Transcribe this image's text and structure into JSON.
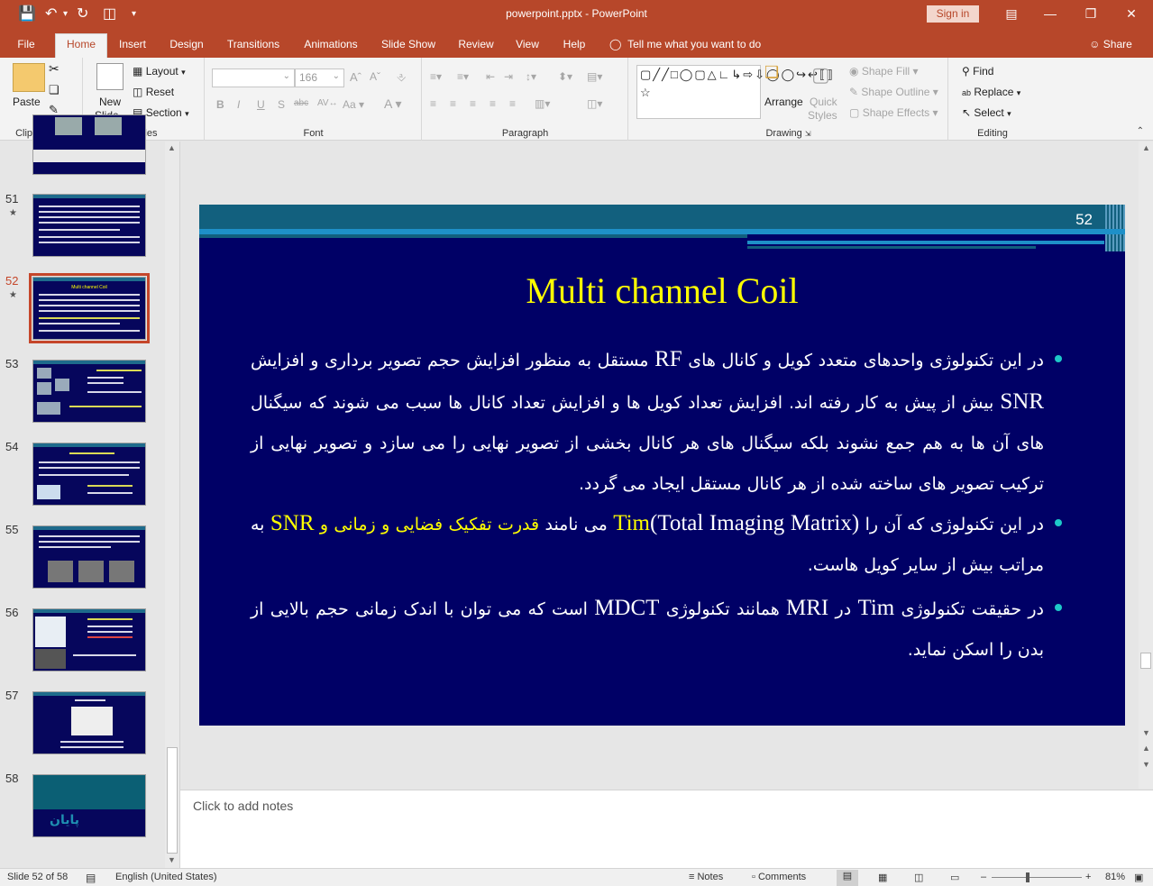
{
  "titlebar": {
    "doc_title": "powerpoint.pptx  -  PowerPoint",
    "sign_in": "Sign in"
  },
  "tabs": [
    "File",
    "Home",
    "Insert",
    "Design",
    "Transitions",
    "Animations",
    "Slide Show",
    "Review",
    "View",
    "Help"
  ],
  "tell_me": "Tell me what you want to do",
  "share": "Share",
  "ribbon": {
    "clipboard": {
      "paste": "Paste",
      "label": "Clipboard"
    },
    "slides": {
      "new_slide": "New",
      "new_slide2": "Slide",
      "layout": "Layout",
      "reset": "Reset",
      "section": "Section",
      "label": "Slides"
    },
    "font": {
      "font_size": "166",
      "label": "Font"
    },
    "paragraph": {
      "label": "Paragraph"
    },
    "drawing": {
      "arrange": "Arrange",
      "quick_styles": "Quick",
      "quick_styles2": "Styles",
      "shape_fill": "Shape Fill",
      "shape_outline": "Shape Outline",
      "shape_effects": "Shape Effects",
      "label": "Drawing"
    },
    "editing": {
      "find": "Find",
      "replace": "Replace",
      "select": "Select",
      "label": "Editing"
    }
  },
  "thumbnails": [
    {
      "num": "51",
      "star": true
    },
    {
      "num": "52",
      "star": true,
      "selected": true,
      "title": "Multi channel Coil"
    },
    {
      "num": "53",
      "star": false
    },
    {
      "num": "54",
      "star": false
    },
    {
      "num": "55",
      "star": false
    },
    {
      "num": "56",
      "star": false
    },
    {
      "num": "57",
      "star": false
    },
    {
      "num": "58",
      "star": false,
      "caption": "پایان"
    }
  ],
  "slide": {
    "number": "52",
    "title": "Multi channel Coil",
    "b1": {
      "t1": "در این تکنولوژی واحدهای متعدد کویل و کانال های ",
      "rf": "RF",
      "t2": " مستقل به منظور افزایش حجم تصویر برداری و افزایش ",
      "snr": "SNR",
      "t3": " بیش از پیش به کار رفته اند. افزایش تعداد کویل ها و افزایش تعداد کانال ها سبب می شوند که سیگنال های آن ها به هم جمع نشوند بلکه سیگنال های هر کانال بخشی از تصویر نهایی را می سازد و تصویر نهایی از ترکیب تصویر های ساخته شده از هر کانال مستقل ایجاد می گردد."
    },
    "b2": {
      "t1": "در این تکنولوژی که آن را ",
      "tim": "Tim",
      "paren": "(Total Imaging Matrix)",
      "t2": " می نامند ",
      "yellow1": "قدرت تفکیک فضایی و زمانی و ",
      "snr": "SNR",
      "t3": " به مراتب بیش از سایر کویل هاست."
    },
    "b3": {
      "t1": "در حقیقت تکنولوژی ",
      "tim": "Tim",
      "t2": " در ",
      "mri": "MRI",
      "t3": " همانند تکنولوژی ",
      "mdct": "MDCT",
      "t4": " است که می توان با اندک زمانی حجم بالایی از بدن را اسکن نماید."
    }
  },
  "notes_placeholder": "Click to add notes",
  "status": {
    "slide_info": "Slide 52 of 58",
    "language": "English (United States)",
    "notes": "Notes",
    "comments": "Comments",
    "zoom": "81%"
  },
  "colors": {
    "accent": "#b7472a",
    "slide_bg": "#000066",
    "title": "#ffff00",
    "bullet": "#1ec8c8",
    "header": "#12607e"
  }
}
